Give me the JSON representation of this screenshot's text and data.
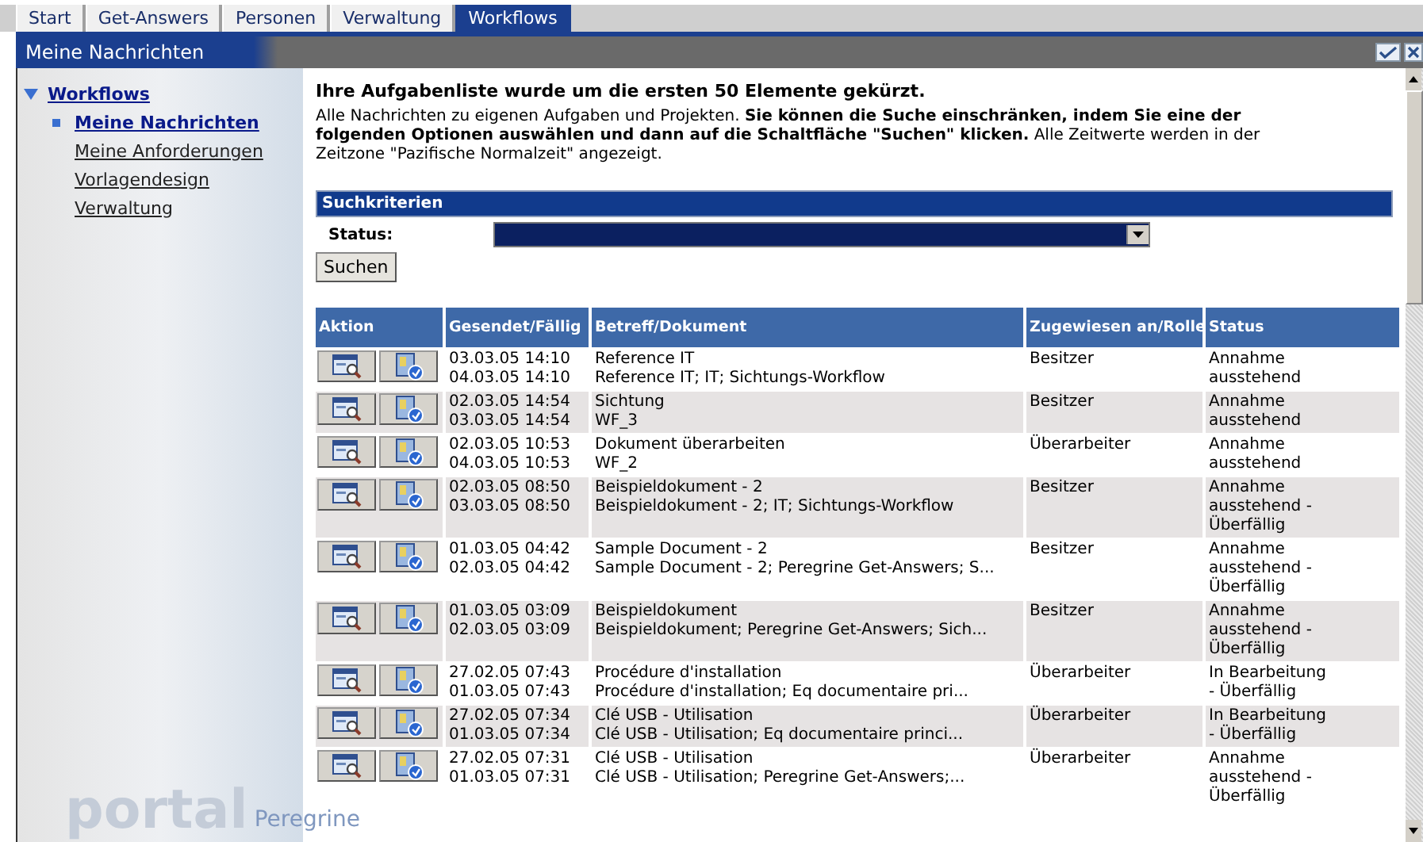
{
  "tabs": [
    {
      "label": "Start",
      "selected": false
    },
    {
      "label": "Get-Answers",
      "selected": false
    },
    {
      "label": "Personen",
      "selected": false
    },
    {
      "label": "Verwaltung",
      "selected": false
    },
    {
      "label": "Workflows",
      "selected": true
    }
  ],
  "panel": {
    "title": "Meine Nachrichten"
  },
  "sidebar": {
    "items": [
      {
        "label": "Workflows",
        "expanded": true,
        "children": [
          {
            "label": "Meine Nachrichten",
            "selected": true
          },
          {
            "label": "Meine Anforderungen",
            "selected": false
          },
          {
            "label": "Vorlagendesign",
            "selected": false
          },
          {
            "label": "Verwaltung",
            "selected": false
          }
        ]
      }
    ]
  },
  "logo": {
    "word": "portal",
    "brand": "Peregrine"
  },
  "notice": "Ihre Aufgabenliste wurde um die ersten 50 Elemente gekürzt.",
  "intro": "Alle Nachrichten zu eigenen Aufgaben und Projekten. **Sie können die Suche einschränken, indem Sie eine der folgenden Optionen auswählen und dann auf die Schaltfläche \"Suchen\" klicken.** Alle Zeitwerte werden in der Zeitzone \"Pazifische Normalzeit\" angezeigt.",
  "search": {
    "title": "Suchkriterien",
    "status_label": "Status:",
    "button": "Suchen"
  },
  "table": {
    "columns": [
      "Aktion",
      "Gesendet/Fällig",
      "Betreff/Dokument",
      "Zugewiesen an/Rolle",
      "Status"
    ],
    "rows": [
      {
        "sent": "03.03.05 14:10",
        "due": "04.03.05 14:10",
        "subject": "Reference IT",
        "document": "Reference IT; IT; Sichtungs-Workflow",
        "role": "Besitzer",
        "status": "Annahme ausstehend"
      },
      {
        "sent": "02.03.05 14:54",
        "due": "03.03.05 14:54",
        "subject": "Sichtung",
        "document": "WF_3",
        "role": "Besitzer",
        "status": "Annahme ausstehend"
      },
      {
        "sent": "02.03.05 10:53",
        "due": "04.03.05 10:53",
        "subject": "Dokument überarbeiten",
        "document": "WF_2",
        "role": "Überarbeiter",
        "status": "Annahme ausstehend"
      },
      {
        "sent": "02.03.05 08:50",
        "due": "03.03.05 08:50",
        "subject": "Beispieldokument - 2",
        "document": "Beispieldokument - 2; IT; Sichtungs-Workflow",
        "role": "Besitzer",
        "status": "Annahme ausstehend - Überfällig"
      },
      {
        "sent": "01.03.05 04:42",
        "due": "02.03.05 04:42",
        "subject": "Sample Document - 2",
        "document": "Sample Document - 2; Peregrine Get-Answers; S...",
        "role": "Besitzer",
        "status": "Annahme ausstehend - Überfällig"
      },
      {
        "sent": "01.03.05 03:09",
        "due": "02.03.05 03:09",
        "subject": "Beispieldokument",
        "document": "Beispieldokument; Peregrine Get-Answers; Sich...",
        "role": "Besitzer",
        "status": "Annahme ausstehend - Überfällig"
      },
      {
        "sent": "27.02.05 07:43",
        "due": "01.03.05 07:43",
        "subject": "Procédure d'installation",
        "document": "Procédure d'installation; Eq documentaire pri...",
        "role": "Überarbeiter",
        "status": "In Bearbeitung - Überfällig"
      },
      {
        "sent": "27.02.05 07:34",
        "due": "01.03.05 07:34",
        "subject": "Clé USB - Utilisation",
        "document": "Clé USB - Utilisation; Eq documentaire princi...",
        "role": "Überarbeiter",
        "status": "In Bearbeitung - Überfällig"
      },
      {
        "sent": "27.02.05 07:31",
        "due": "01.03.05 07:31",
        "subject": "Clé USB - Utilisation",
        "document": "Clé USB - Utilisation; Peregrine Get-Answers;...",
        "role": "Überarbeiter",
        "status": "Annahme ausstehend - Überfällig"
      }
    ]
  }
}
